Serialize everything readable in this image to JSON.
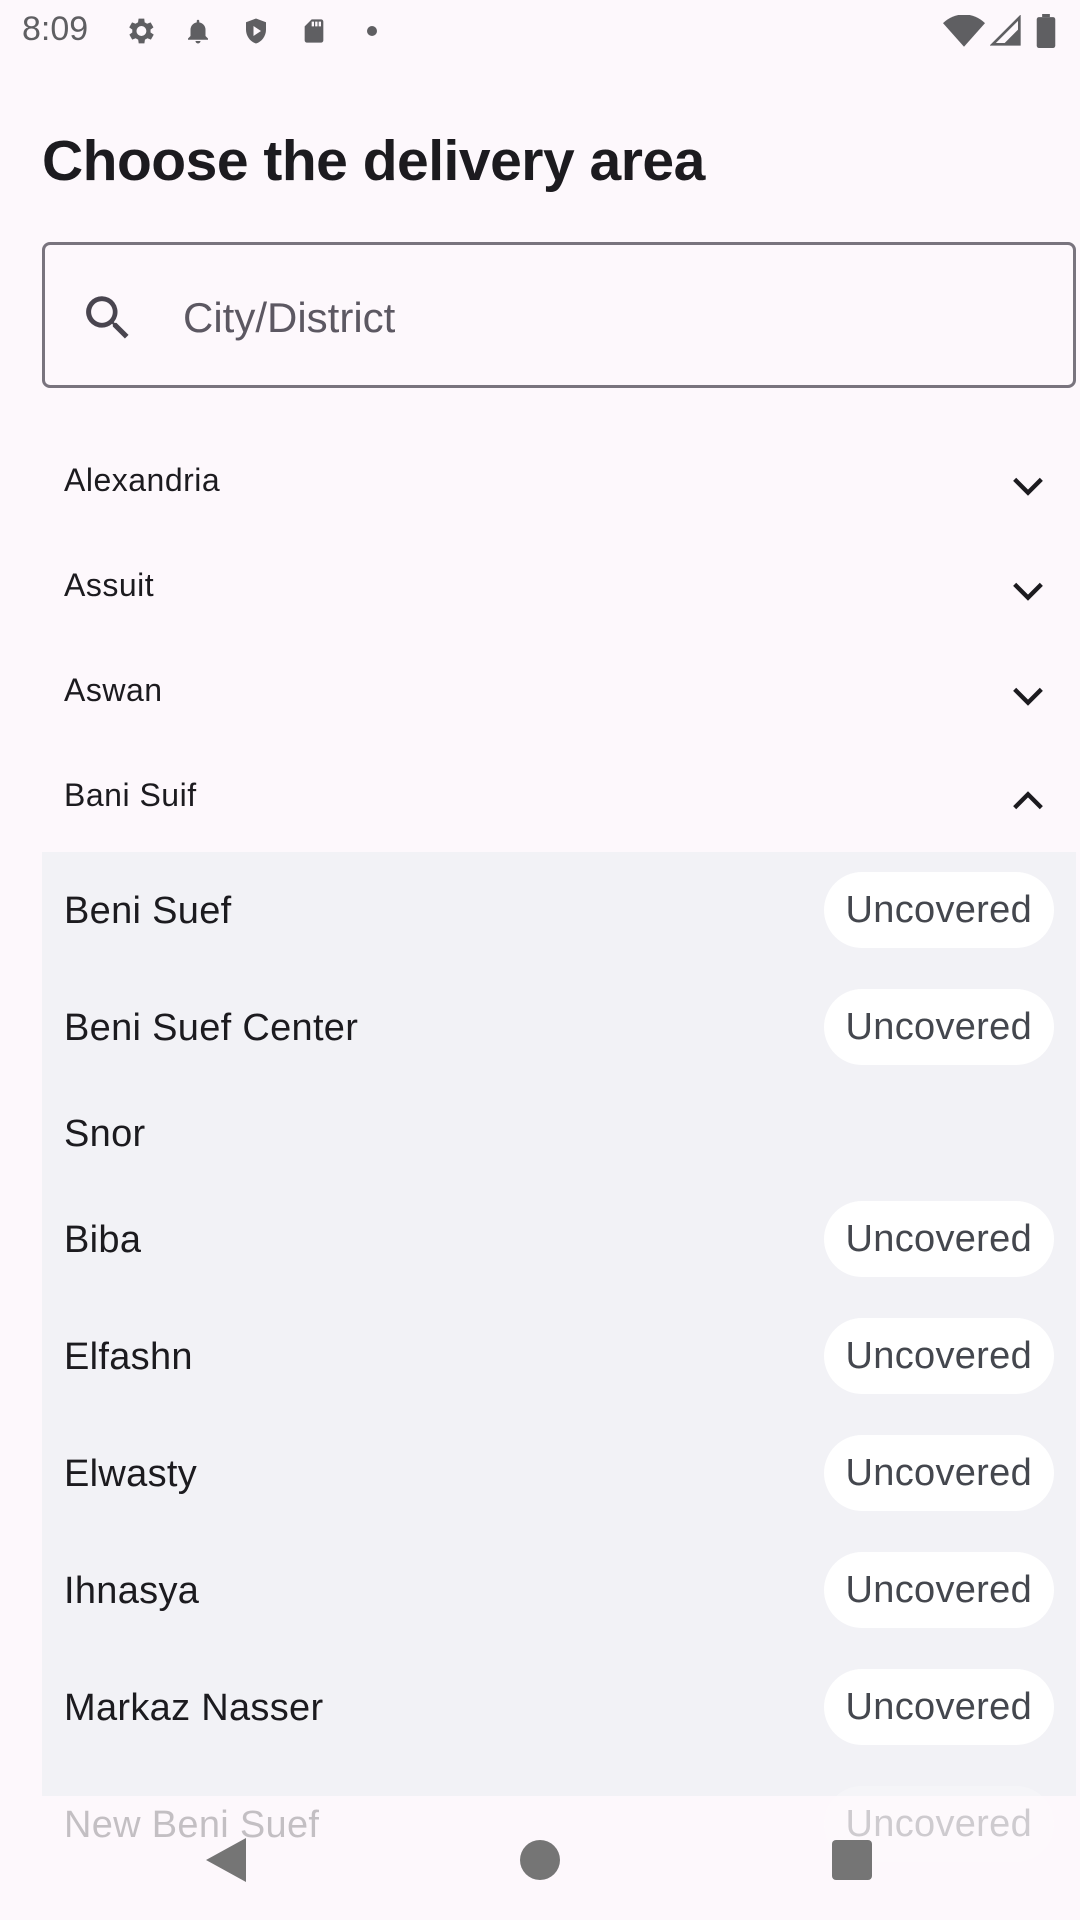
{
  "status_bar": {
    "time": "8:09",
    "left_icons": [
      "gear-icon",
      "bell-icon",
      "shield-icon",
      "sd-card-icon",
      "dot-icon"
    ],
    "right_icons": [
      "wifi-icon",
      "signal-icon",
      "battery-icon"
    ]
  },
  "page": {
    "title": "Choose the delivery area"
  },
  "search": {
    "placeholder": "City/District",
    "value": ""
  },
  "governorates": [
    {
      "label": "Alexandria",
      "expanded": false
    },
    {
      "label": "Assuit",
      "expanded": false
    },
    {
      "label": "Aswan",
      "expanded": false
    },
    {
      "label": "Bani Suif",
      "expanded": true
    }
  ],
  "districts": [
    {
      "label": "Beni Suef",
      "badge": "Uncovered"
    },
    {
      "label": "Beni Suef Center",
      "badge": "Uncovered"
    },
    {
      "label": "Snor",
      "badge": ""
    },
    {
      "label": "Biba",
      "badge": "Uncovered"
    },
    {
      "label": "Elfashn",
      "badge": "Uncovered"
    },
    {
      "label": "Elwasty",
      "badge": "Uncovered"
    },
    {
      "label": "Ihnasya",
      "badge": "Uncovered"
    },
    {
      "label": "Markaz Nasser",
      "badge": "Uncovered"
    },
    {
      "label": "New Beni Suef",
      "badge": "Uncovered"
    }
  ],
  "colors": {
    "background": "#fdf8fc",
    "panel": "#f2f2f6",
    "badge_bg": "#ffffff",
    "outline": "#79747e"
  }
}
